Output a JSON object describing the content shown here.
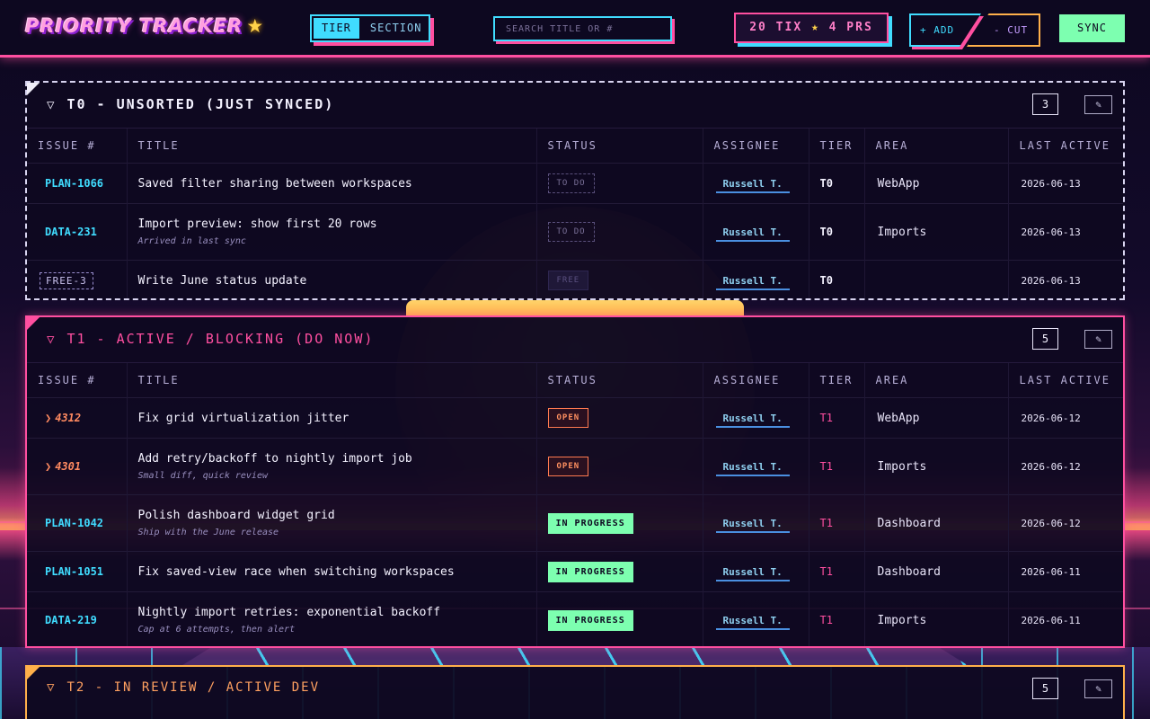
{
  "app": {
    "title": "PRIORITY TRACKER",
    "title_star": "★"
  },
  "header": {
    "view_toggle": {
      "options": [
        "TIER",
        "SECTION"
      ],
      "selected": "TIER"
    },
    "search": {
      "placeholder": "SEARCH TITLE OR #",
      "value": ""
    },
    "counter": {
      "tickets": "20 TIX",
      "star": "★",
      "prs": "4 PRS"
    },
    "add_label": "+ ADD",
    "cut_label": "- CUT",
    "sync_label": "SYNC"
  },
  "columns": [
    "ISSUE #",
    "TITLE",
    "STATUS",
    "ASSIGNEE",
    "TIER",
    "AREA",
    "LAST ACTIVE"
  ],
  "tiers": [
    {
      "title": "T0 - UNSORTED (JUST SYNCED)",
      "count": "3",
      "edit_icon": "pencil-icon",
      "rows": [
        {
          "issue": "PLAN-1066",
          "issue_kind": "link",
          "title": "Saved filter sharing between workspaces",
          "note": "",
          "status": "TO DO",
          "assignee": "Russell T.",
          "tier": "T0",
          "area": "WebApp",
          "last_active": "2026-06-13"
        },
        {
          "issue": "DATA-231",
          "issue_kind": "link",
          "title": "Import preview: show first 20 rows",
          "note": "Arrived in last sync",
          "status": "TO DO",
          "assignee": "Russell T.",
          "tier": "T0",
          "area": "Imports",
          "last_active": "2026-06-13"
        },
        {
          "issue": "FREE-3",
          "issue_kind": "free",
          "title": "Write June status update",
          "note": "",
          "status": "FREE",
          "assignee": "Russell T.",
          "tier": "T0",
          "area": "",
          "last_active": "2026-06-13"
        }
      ]
    },
    {
      "title": "T1 - ACTIVE / BLOCKING (DO NOW)",
      "count": "5",
      "edit_icon": "pencil-icon",
      "rows": [
        {
          "issue": "4312",
          "issue_kind": "pr",
          "title": "Fix grid virtualization jitter",
          "note": "",
          "status": "OPEN",
          "assignee": "Russell T.",
          "tier": "T1",
          "area": "WebApp",
          "last_active": "2026-06-12"
        },
        {
          "issue": "4301",
          "issue_kind": "pr",
          "title": "Add retry/backoff to nightly import job",
          "note": "Small diff, quick review",
          "status": "OPEN",
          "assignee": "Russell T.",
          "tier": "T1",
          "area": "Imports",
          "last_active": "2026-06-12"
        },
        {
          "issue": "PLAN-1042",
          "issue_kind": "link",
          "title": "Polish dashboard widget grid",
          "note": "Ship with the June release",
          "status": "IN PROGRESS",
          "assignee": "Russell T.",
          "tier": "T1",
          "area": "Dashboard",
          "last_active": "2026-06-12"
        },
        {
          "issue": "PLAN-1051",
          "issue_kind": "link",
          "title": "Fix saved-view race when switching workspaces",
          "note": "",
          "status": "IN PROGRESS",
          "assignee": "Russell T.",
          "tier": "T1",
          "area": "Dashboard",
          "last_active": "2026-06-11"
        },
        {
          "issue": "DATA-219",
          "issue_kind": "link",
          "title": "Nightly import retries: exponential backoff",
          "note": "Cap at 6 attempts, then alert",
          "status": "IN PROGRESS",
          "assignee": "Russell T.",
          "tier": "T1",
          "area": "Imports",
          "last_active": "2026-06-11"
        }
      ]
    },
    {
      "title": "T2 - IN REVIEW / ACTIVE DEV",
      "count": "5",
      "edit_icon": "pencil-icon",
      "rows": []
    }
  ],
  "colors": {
    "accent_pink": "#ff4fa0",
    "accent_cyan": "#40dcff",
    "accent_green": "#7dffb0",
    "accent_orange": "#ffb04a",
    "pr_orange": "#ff8a60"
  }
}
